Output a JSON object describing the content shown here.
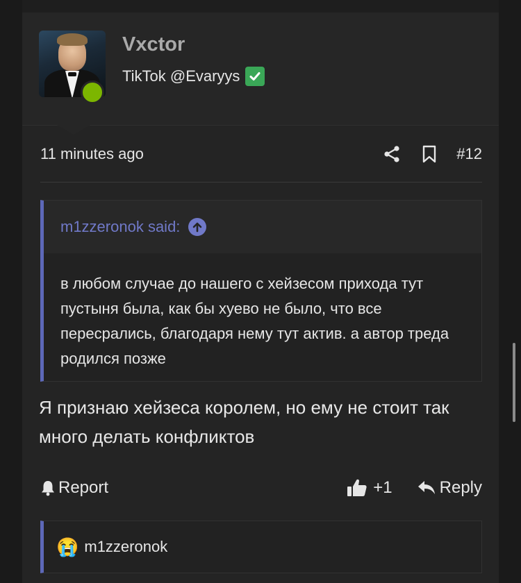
{
  "post": {
    "author": {
      "name": "Vxctor",
      "title": "TikTok @Evaryys",
      "title_emoji": "✅"
    },
    "time": "11 minutes ago",
    "number": "#12",
    "quote": {
      "author_said": "m1zzeronok said:",
      "text": "в любом случае до нашего с хейзесом прихода тут пустыня была, как бы хуево не было, что все пересрались, благодаря нему тут актив. а автор треда родился позже"
    },
    "message": "Я признаю хейзеса королем, но ему не стоит так много делать конфликтов",
    "actions": {
      "report_label": "Report",
      "like_count": "+1",
      "reply_label": "Reply"
    },
    "reactions": {
      "emoji": "😭",
      "user": "m1zzeronok"
    }
  },
  "colors": {
    "background": "#1a1a1a",
    "panel": "#242424",
    "accent_quote": "#5d68b8",
    "quote_author": "#7079c8",
    "online": "#7cb600"
  },
  "icons": {
    "share": "share-icon",
    "bookmark": "bookmark-icon",
    "up": "arrow-up-icon",
    "report": "bell-icon",
    "like": "thumbs-up-icon",
    "reply": "reply-icon"
  }
}
